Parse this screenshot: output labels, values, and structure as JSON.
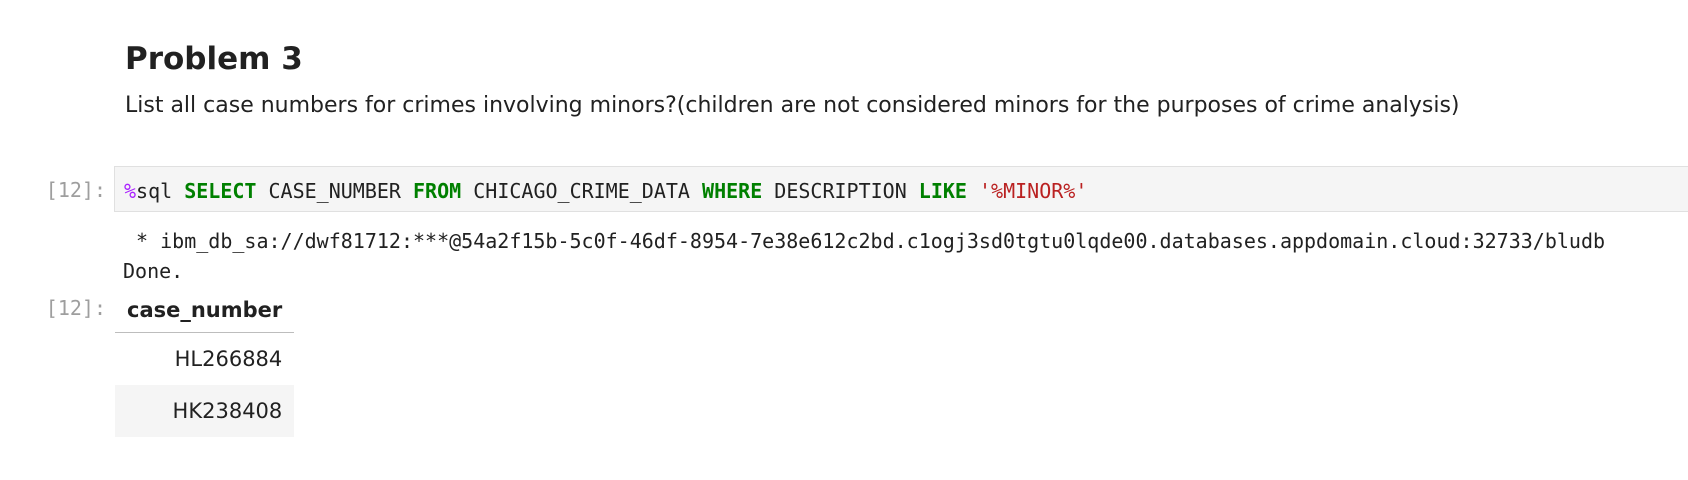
{
  "markdown": {
    "heading": "Problem 3",
    "text": "List all case numbers for crimes involving minors?(children are not considered minors for the purposes of crime analysis)"
  },
  "code_cell": {
    "prompt": "[12]:",
    "tokens": {
      "magic_symbol": "%",
      "magic_name": "sql",
      "kw_select": "SELECT",
      "col": "CASE_NUMBER",
      "kw_from": "FROM",
      "table": "CHICAGO_CRIME_DATA",
      "kw_where": "WHERE",
      "field": "DESCRIPTION",
      "kw_like": "LIKE",
      "pattern": "'%MINOR%'"
    }
  },
  "stdout": {
    "connection": " * ibm_db_sa://dwf81712:***@54a2f15b-5c0f-46df-8954-7e38e612c2bd.c1ogj3sd0tgtu0lqde00.databases.appdomain.cloud:32733/bludb",
    "done": "Done."
  },
  "output": {
    "prompt": "[12]:",
    "table": {
      "header": "case_number",
      "rows": [
        "HL266884",
        "HK238408"
      ]
    }
  }
}
